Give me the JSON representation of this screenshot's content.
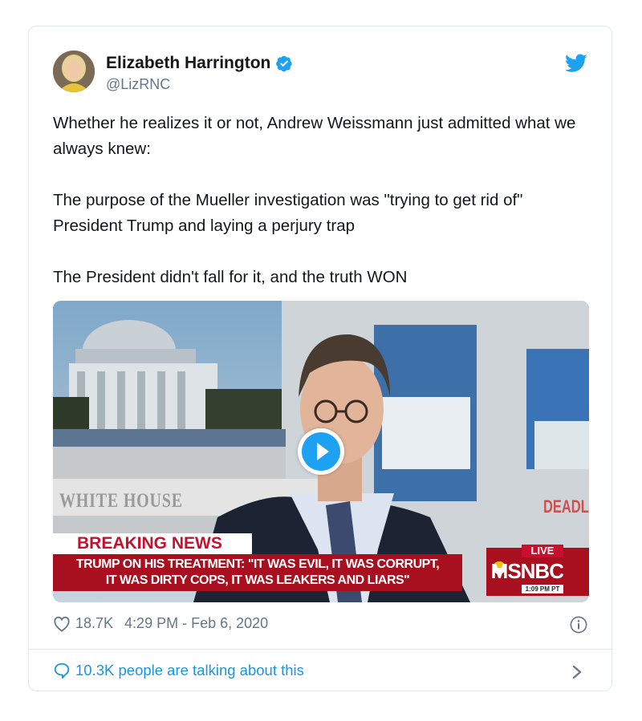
{
  "author": {
    "name": "Elizabeth Harrington",
    "handle": "@LizRNC",
    "verified": true
  },
  "tweet": {
    "paragraphs": [
      "Whether he realizes it or not, Andrew Weissmann just admitted what we always knew:",
      "The purpose of the Mueller investigation was \"trying to get rid of\" President Trump and laying a perjury trap",
      "The President didn't fall for it, and the truth WON"
    ]
  },
  "media": {
    "type": "video",
    "backdrop_sign": "WHITE HOUSE",
    "backdrop_sign_right": "DEADL",
    "banner": "BREAKING NEWS",
    "headline_line1": "TRUMP ON HIS TREATMENT: \"IT WAS EVIL, IT WAS CORRUPT,",
    "headline_line2": "IT WAS DIRTY COPS, IT WAS LEAKERS AND LIARS\"",
    "live_label": "LIVE",
    "network": "MSNBC",
    "broadcast_time": "1:09 PM PT"
  },
  "meta": {
    "likes": "18.7K",
    "timestamp": "4:29 PM - Feb 6, 2020"
  },
  "footer": {
    "talking": "10.3K people are talking about this"
  },
  "colors": {
    "twitter_blue": "#1da1f2",
    "link_blue": "#1b95e0",
    "secondary_text": "#657786",
    "border": "#e1e8ed",
    "news_red": "#a8101f"
  },
  "icons": [
    "verified-badge-icon",
    "twitter-bird-icon",
    "play-icon",
    "heart-icon",
    "info-icon",
    "speech-bubble-icon",
    "chevron-right-icon"
  ]
}
